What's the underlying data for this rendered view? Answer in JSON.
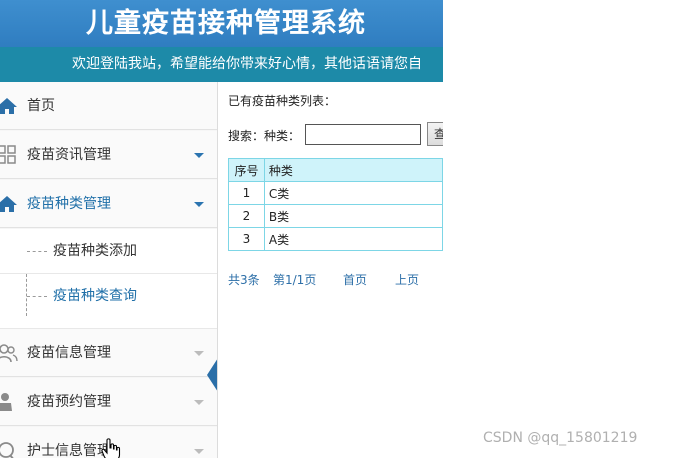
{
  "header": {
    "title": "儿童疫苗接种管理系统",
    "welcome": "欢迎登陆我站，希望能给你带来好心情，其他话语请您自"
  },
  "sidebar": {
    "items": [
      {
        "label": "首页",
        "icon": "home-icon"
      },
      {
        "label": "疫苗资讯管理",
        "icon": "grid-icon"
      },
      {
        "label": "疫苗种类管理",
        "icon": "home-icon"
      },
      {
        "label": "疫苗信息管理",
        "icon": "users-icon"
      },
      {
        "label": "疫苗预约管理",
        "icon": "user-icon"
      },
      {
        "label": "护士信息管理",
        "icon": "chat-icon"
      }
    ],
    "subitems": [
      {
        "label": "疫苗种类添加"
      },
      {
        "label": "疫苗种类查询"
      }
    ]
  },
  "main": {
    "list_title": "已有疫苗种类列表：",
    "search_label": "搜索：种类：",
    "search_value": "",
    "search_button": "查",
    "table": {
      "headers": [
        "序号",
        "种类"
      ],
      "rows": [
        [
          "1",
          "C类"
        ],
        [
          "2",
          "B类"
        ],
        [
          "3",
          "A类"
        ]
      ]
    },
    "pager": {
      "total": "共3条",
      "page": "第1/1页",
      "first": "首页",
      "prev": "上页"
    }
  },
  "watermark": "CSDN @qq_15801219",
  "colors": {
    "header_blue": "#3f8fcf",
    "welcome_teal": "#1d8aa8",
    "link_blue": "#2d6fa8",
    "table_border": "#7dd6e6",
    "table_header": "#cff3fa"
  }
}
